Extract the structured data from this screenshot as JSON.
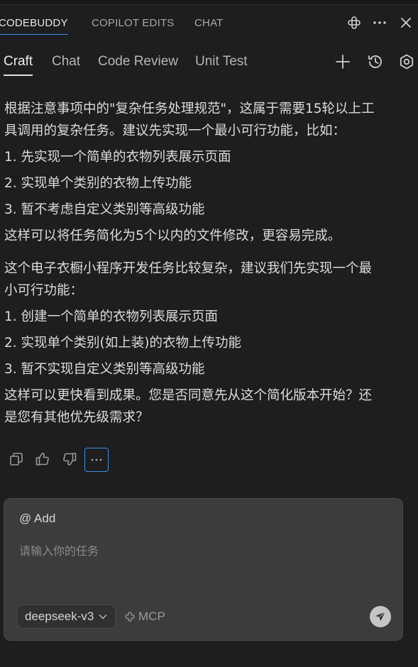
{
  "panel_tabs": [
    {
      "label": "CODEBUDDY",
      "active": true
    },
    {
      "label": "COPILOT EDITS",
      "active": false
    },
    {
      "label": "CHAT",
      "active": false
    }
  ],
  "top_icons": [
    "kite-icon",
    "more-icon",
    "close-icon"
  ],
  "sub_tabs": [
    {
      "label": "Craft",
      "active": true
    },
    {
      "label": "Chat",
      "active": false
    },
    {
      "label": "Code Review",
      "active": false
    },
    {
      "label": "Unit Test",
      "active": false
    }
  ],
  "sub_icons": [
    "plus-icon",
    "history-icon",
    "settings-icon"
  ],
  "message": {
    "block1": [
      "根据注意事项中的\"复杂任务处理规范\"，这属于需要15轮以上工",
      "具调用的复杂任务。建议先实现一个最小可行功能，比如：",
      "1. 先实现一个简单的衣物列表展示页面",
      "2. 实现单个类别的衣物上传功能",
      "3. 暂不考虑自定义类别等高级功能",
      "这样可以将任务简化为5个以内的文件修改，更容易完成。"
    ],
    "block2": [
      "这个电子衣橱小程序开发任务比较复杂，建议我们先实现一个最",
      "小可行功能：",
      "1. 创建一个简单的衣物列表展示页面",
      "2. 实现单个类别(如上装)的衣物上传功能",
      "3. 暂不实现自定义类别等高级功能",
      "这样可以更快看到成果。您是否同意先从这个简化版本开始？还",
      "是您有其他优先级需求？"
    ]
  },
  "actions": [
    "copy-icon",
    "thumbs-up-icon",
    "thumbs-down-icon",
    "more-icon"
  ],
  "input": {
    "add_label": "@ Add",
    "placeholder": "请输入你的任务",
    "value": "",
    "model": "deepseek-v3",
    "mcp_label": "MCP"
  },
  "colors": {
    "background": "#1e1e1e",
    "accent": "#3b8eea",
    "input_bg": "#3c3c3c"
  }
}
